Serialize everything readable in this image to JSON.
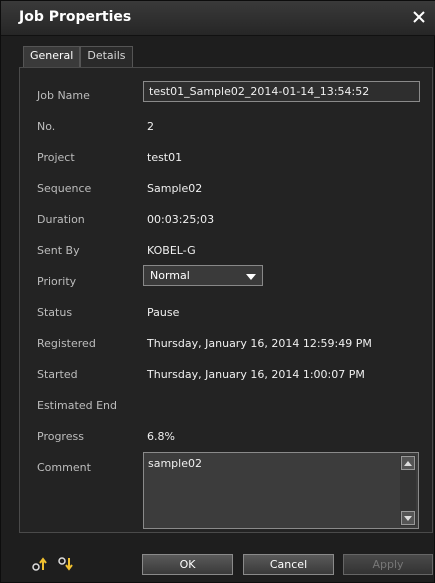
{
  "window": {
    "title": "Job Properties"
  },
  "tabs": [
    {
      "label": "General"
    },
    {
      "label": "Details"
    }
  ],
  "fields": {
    "job_name": {
      "label": "Job Name",
      "value": "test01_Sample02_2014-01-14_13:54:52"
    },
    "no": {
      "label": "No.",
      "value": "2"
    },
    "project": {
      "label": "Project",
      "value": "test01"
    },
    "sequence": {
      "label": "Sequence",
      "value": "Sample02"
    },
    "duration": {
      "label": "Duration",
      "value": "00:03:25;03"
    },
    "sent_by": {
      "label": "Sent By",
      "value": "KOBEL-G"
    },
    "priority": {
      "label": "Priority",
      "value": "Normal"
    },
    "status": {
      "label": "Status",
      "value": "Pause"
    },
    "registered": {
      "label": "Registered",
      "value": "Thursday, January 16, 2014 12:59:49 PM"
    },
    "started": {
      "label": "Started",
      "value": "Thursday, January 16, 2014 1:00:07 PM"
    },
    "estimated_end": {
      "label": "Estimated End",
      "value": ""
    },
    "progress": {
      "label": "Progress",
      "value": "6.8%"
    },
    "comment": {
      "label": "Comment",
      "value": "sample02"
    }
  },
  "buttons": {
    "ok": "OK",
    "cancel": "Cancel",
    "apply": "Apply"
  },
  "icons": {
    "close": "close-icon",
    "footer_left": "job-up-icon",
    "footer_right": "job-down-icon"
  }
}
